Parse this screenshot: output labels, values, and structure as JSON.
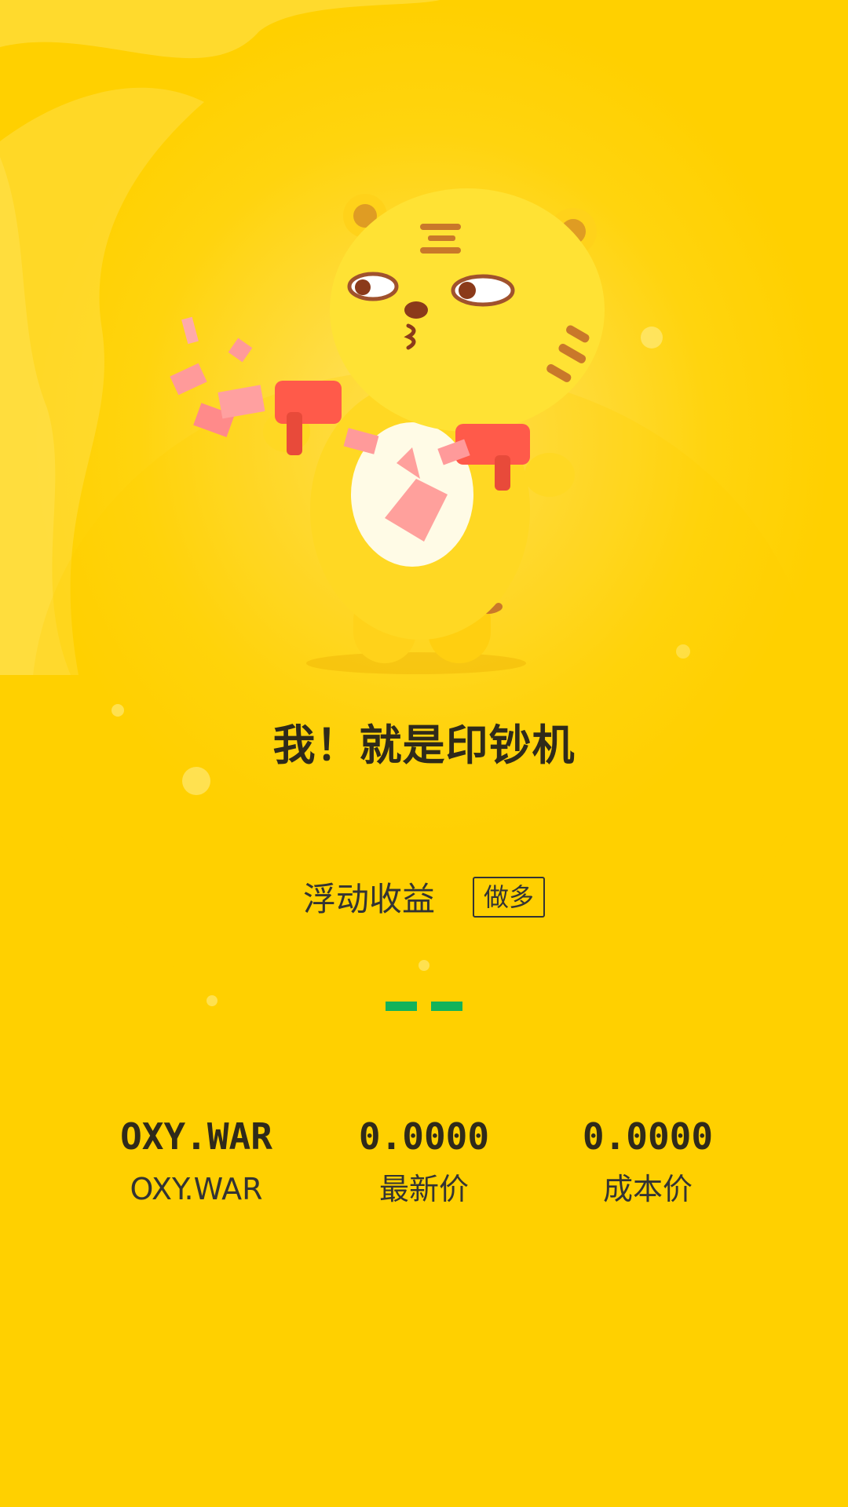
{
  "headline": "我！就是印钞机",
  "position": {
    "pl_label": "浮动收益",
    "direction": "做多"
  },
  "pager": {
    "indicator_color": "#12b35a",
    "count": 2
  },
  "stats": [
    {
      "value": "OXY.WAR",
      "label": "OXY.WAR"
    },
    {
      "value": "0.0000",
      "label": "最新价"
    },
    {
      "value": "0.0000",
      "label": "成本价"
    }
  ],
  "theme": {
    "background": "#ffd400",
    "text": "#333333",
    "accent": "#12b35a"
  },
  "illustration": "tiger-mascot-money-guns"
}
